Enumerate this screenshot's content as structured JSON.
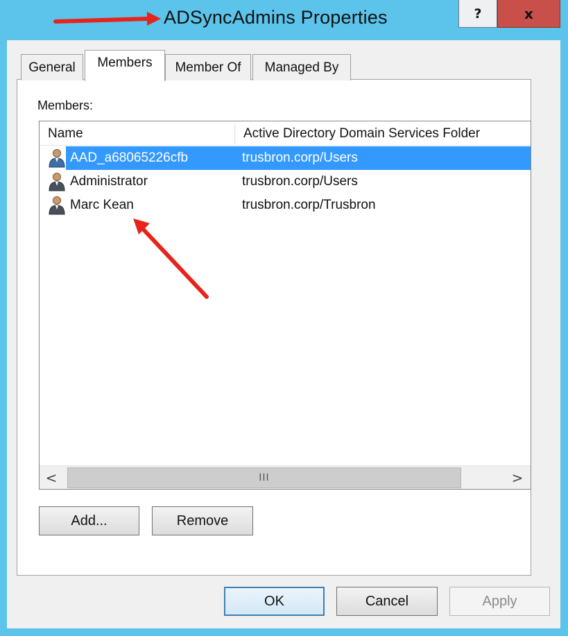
{
  "window": {
    "title": "ADSyncAdmins Properties",
    "help_label": "?",
    "close_label": "x"
  },
  "tabs": [
    {
      "label": "General"
    },
    {
      "label": "Members"
    },
    {
      "label": "Member Of"
    },
    {
      "label": "Managed By"
    }
  ],
  "members": {
    "label": "Members:",
    "columns": [
      "Name",
      "Active Directory Domain Services Folder"
    ],
    "rows": [
      {
        "name": "AAD_a68065226cfb",
        "folder": "trusbron.corp/Users",
        "selected": true
      },
      {
        "name": "Administrator",
        "folder": "trusbron.corp/Users",
        "selected": false
      },
      {
        "name": "Marc Kean",
        "folder": "trusbron.corp/Trusbron",
        "selected": false
      }
    ],
    "scroll_left": "<",
    "scroll_right": ">",
    "scroll_grip": "III",
    "add_label": "Add...",
    "remove_label": "Remove"
  },
  "footer": {
    "ok_label": "OK",
    "cancel_label": "Cancel",
    "apply_label": "Apply"
  },
  "colors": {
    "accent": "#3399ff",
    "annotation_arrow": "#e8231b",
    "frame": "#5cc3ea",
    "close": "#c9504a"
  },
  "icons": {
    "user": "user-icon",
    "annotation": "red-arrow-icon"
  }
}
